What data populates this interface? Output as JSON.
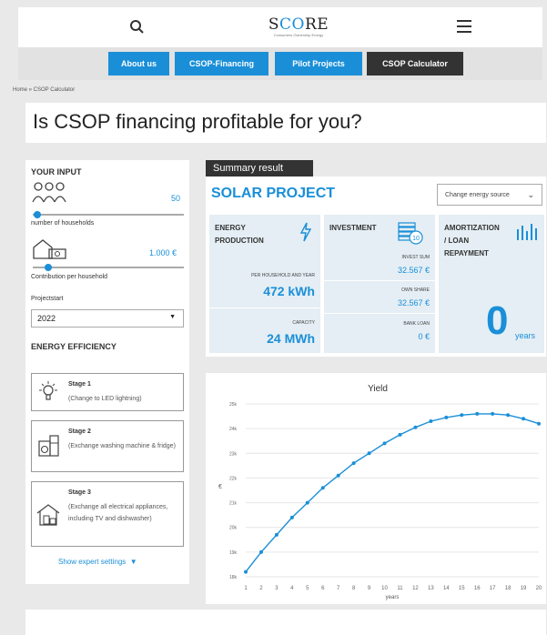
{
  "header": {
    "logo": "SCORE",
    "logo_tagline": "Consumers Ownership Energy"
  },
  "nav": [
    "About us",
    "CSOP-Financing",
    "Pilot Projects",
    "CSOP Calculator"
  ],
  "breadcrumb": "Home » CSOP Calculator",
  "page_title": "Is CSOP financing profitable for you?",
  "input": {
    "heading": "YOUR INPUT",
    "households_value": "50",
    "households_label": "number of households",
    "contribution_value": "1.000 €",
    "contribution_label": "Contribution per household",
    "households_level": 0.03,
    "contribution_level": 0.1,
    "projectstart_label": "Projectstart",
    "projectstart_value": "2022",
    "efficiency_heading": "ENERGY EFFICIENCY",
    "stages": [
      {
        "title": "Stage 1",
        "desc": "(Change to LED lightning)",
        "icon": "lightbulb-icon"
      },
      {
        "title": "Stage 2",
        "desc": "(Exchange washing machine & fridge)",
        "icon": "washing-machine-icon"
      },
      {
        "title": "Stage 3",
        "desc": "(Exchange all electrical appliances, including TV and dishwasher)",
        "icon": "house-appliances-icon"
      }
    ],
    "expert_label": "Show expert settings"
  },
  "summary": {
    "tab": "Summary result",
    "project": "SOLAR PROJECT",
    "energy_source_placeholder": "Change energy source",
    "energy": {
      "heading_1": "ENERGY",
      "heading_2": "PRODUCTION",
      "per_household_label": "PER HOUSEHOLD AND YEAR",
      "per_household_value": "472 kWh",
      "capacity_label": "CAPACITY",
      "capacity_value": "24 MWh"
    },
    "investment": {
      "heading": "INVESTMENT",
      "sum_label": "INVEST SUM",
      "sum_value": "32.567 €",
      "own_label": "OWN SHARE",
      "own_value": "32.567 €",
      "loan_label": "BANK LOAN",
      "loan_value": "0 €"
    },
    "amortization": {
      "heading_1": "AMORTIZATION",
      "heading_2": "/ LOAN",
      "heading_3": "REPAYMENT",
      "value": "0",
      "unit": "years"
    }
  },
  "colors": {
    "accent": "#1a8fd8",
    "dark": "#333333",
    "card": "#e4eef4"
  },
  "chart_data": {
    "type": "line",
    "title": "Yield",
    "xlabel": "years",
    "ylabel": "€",
    "x": [
      1,
      2,
      3,
      4,
      5,
      6,
      7,
      8,
      9,
      10,
      11,
      12,
      13,
      14,
      15,
      16,
      17,
      18,
      19,
      20
    ],
    "values": [
      16.2,
      17.0,
      17.7,
      18.4,
      19.0,
      19.6,
      20.1,
      20.6,
      21.0,
      21.4,
      21.75,
      22.05,
      22.3,
      22.45,
      22.55,
      22.6,
      22.6,
      22.55,
      22.4,
      22.2
    ],
    "ylim": [
      16,
      23
    ],
    "y_ticks": [
      16,
      17,
      18,
      19,
      20,
      21,
      22,
      23
    ],
    "y_tick_labels": [
      "18k",
      "19k",
      "20k",
      "21k",
      "22k",
      "23k",
      "24k",
      "25k"
    ],
    "grid": "horizontal"
  }
}
